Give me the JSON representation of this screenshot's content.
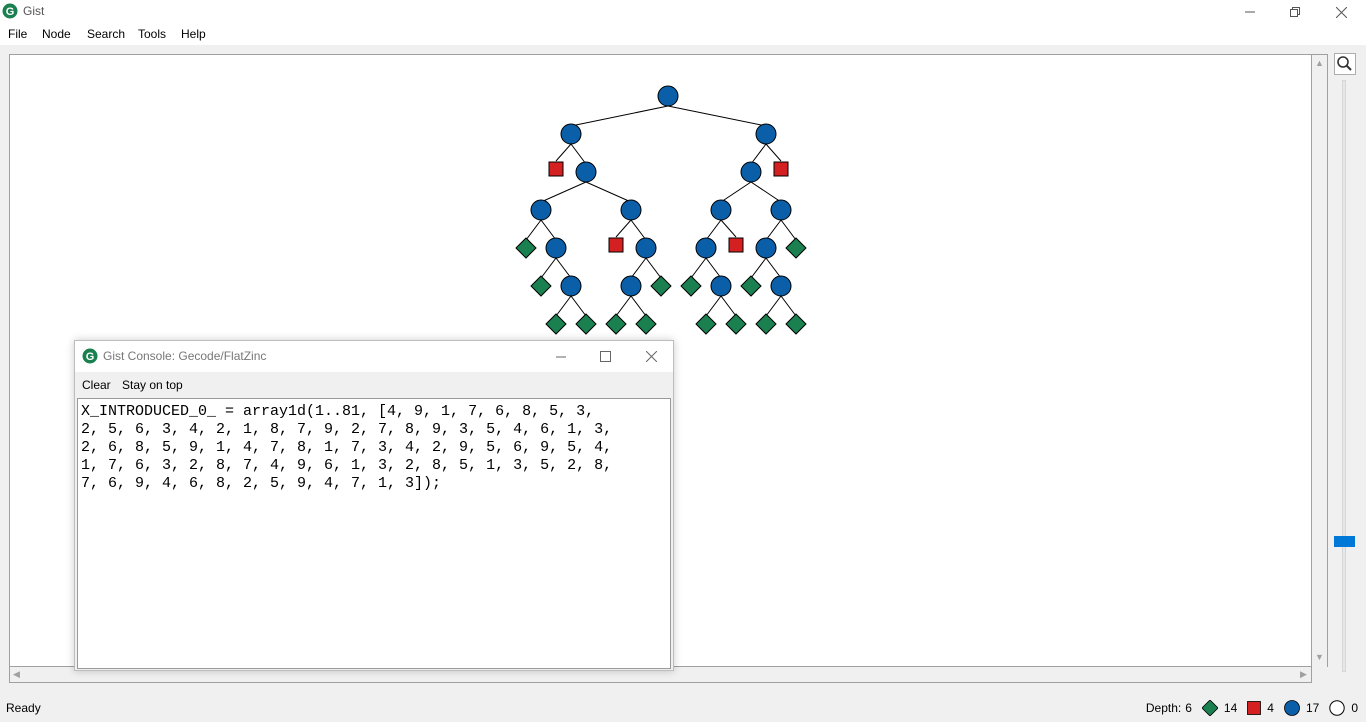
{
  "window": {
    "title": "Gist",
    "icon": "gist-logo-icon"
  },
  "menu": [
    "File",
    "Node",
    "Search",
    "Tools",
    "Help"
  ],
  "colors": {
    "choice_node": "#0a5fa8",
    "solution_node": "#1a8050",
    "failed_node": "#d42020",
    "zoom_handle": "#0078d7"
  },
  "status": {
    "text": "Ready",
    "depth_label": "Depth:",
    "depth": "6",
    "solved_count": "14",
    "failed_count": "4",
    "choice_count": "17",
    "open_count": "0"
  },
  "console": {
    "title": "Gist Console: Gecode/FlatZinc",
    "clear_label": "Clear",
    "stay_on_top_label": "Stay on top",
    "output": "X_INTRODUCED_0_ = array1d(1..81, [4, 9, 1, 7, 6, 8, 5, 3,\n2, 5, 6, 3, 4, 2, 1, 8, 7, 9, 2, 7, 8, 9, 3, 5, 4, 6, 1, 3,\n2, 6, 8, 5, 9, 1, 4, 7, 8, 1, 7, 3, 4, 2, 9, 5, 6, 9, 5, 4,\n1, 7, 6, 3, 2, 8, 7, 4, 9, 6, 1, 3, 2, 8, 5, 1, 3, 5, 2, 8,\n7, 6, 9, 4, 6, 8, 2, 5, 9, 4, 7, 1, 3]);"
  }
}
